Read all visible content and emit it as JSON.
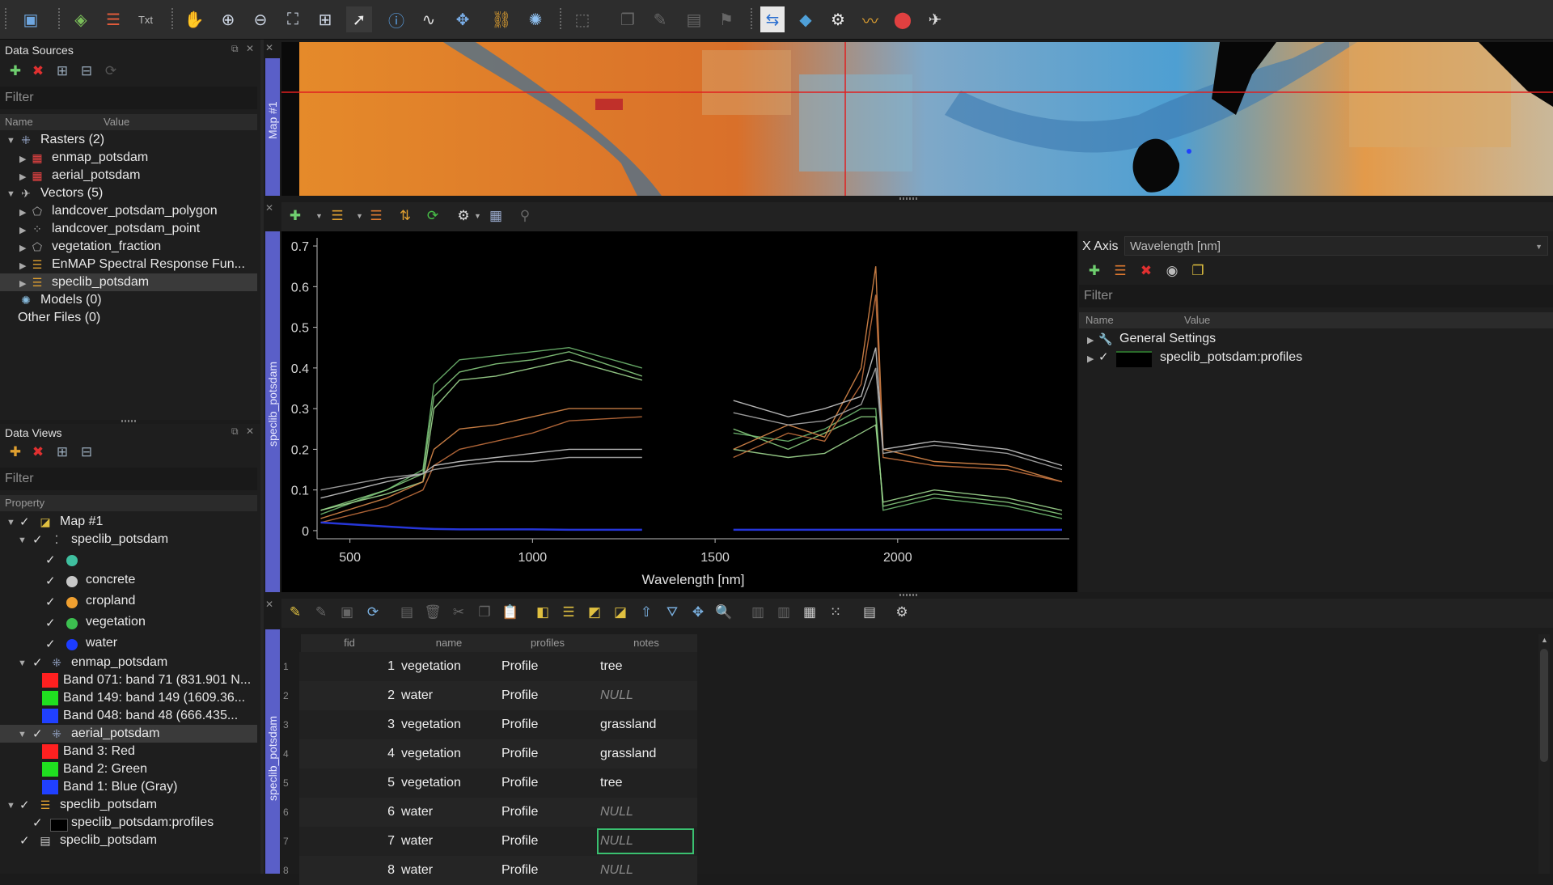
{
  "data_sources": {
    "title": "Data Sources",
    "filter_placeholder": "Filter",
    "col_name": "Name",
    "col_value": "Value",
    "rasters_label": "Rasters (2)",
    "raster_items": [
      "enmap_potsdam",
      "aerial_potsdam"
    ],
    "vectors_label": "Vectors (5)",
    "vector_items": [
      "landcover_potsdam_polygon",
      "landcover_potsdam_point",
      "vegetation_fraction",
      "EnMAP Spectral Response Fun...",
      "speclib_potsdam"
    ],
    "models_label": "Models (0)",
    "other_files_label": "Other Files (0)"
  },
  "data_views": {
    "title": "Data Views",
    "filter_placeholder": "Filter",
    "col_property": "Property",
    "map_label": "Map #1",
    "speclib_layer": "speclib_potsdam",
    "classes": [
      {
        "label": "",
        "color": "#3fbf9f"
      },
      {
        "label": "concrete",
        "color": "#c8c8c8"
      },
      {
        "label": "cropland",
        "color": "#f0a030"
      },
      {
        "label": "vegetation",
        "color": "#3cc050"
      },
      {
        "label": "water",
        "color": "#1c3cff"
      }
    ],
    "enmap_layer": "enmap_potsdam",
    "enmap_bands": [
      {
        "label": "Band 071: band 71 (831.901 N...",
        "color": "#ff2020"
      },
      {
        "label": "Band 149: band 149 (1609.36...",
        "color": "#20e020"
      },
      {
        "label": "Band 048: band 48 (666.435...",
        "color": "#2040ff"
      }
    ],
    "aerial_layer": "aerial_potsdam",
    "aerial_bands": [
      {
        "label": "Band 3: Red",
        "color": "#ff2020"
      },
      {
        "label": "Band 2: Green",
        "color": "#20e020"
      },
      {
        "label": "Band 1: Blue (Gray)",
        "color": "#2040ff"
      }
    ],
    "speclib_view": "speclib_potsdam",
    "speclib_profiles": "speclib_potsdam:profiles",
    "speclib_table": "speclib_potsdam"
  },
  "map_tab": "Map #1",
  "speclib_tab": "speclib_potsdam",
  "table_tab": "speclib_potsdam",
  "plot_settings": {
    "xaxis_label": "X Axis",
    "xaxis_value": "Wavelength [nm]",
    "filter_placeholder": "Filter",
    "col_name": "Name",
    "col_value": "Value",
    "general_settings": "General Settings",
    "profile_layer": "speclib_potsdam:profiles"
  },
  "chart_data": {
    "type": "line",
    "xlabel": "Wavelength [nm]",
    "ylabel": "",
    "xlim": [
      410,
      2470
    ],
    "ylim": [
      -0.02,
      0.72
    ],
    "xticks": [
      500,
      1000,
      1500,
      2000
    ],
    "yticks": [
      0,
      0.1,
      0.2,
      0.3,
      0.4,
      0.5,
      0.6,
      0.7
    ],
    "series": [
      {
        "color": "#6fb870",
        "x": [
          420,
          600,
          700,
          730,
          800,
          900,
          1000,
          1100,
          1300,
          1450,
          1460,
          1550,
          1700,
          1800,
          1900,
          1940,
          1960,
          2100,
          2300,
          2450
        ],
        "y": [
          0.04,
          0.1,
          0.15,
          0.36,
          0.42,
          0.43,
          0.44,
          0.45,
          0.4,
          null,
          null,
          0.24,
          0.22,
          0.25,
          0.3,
          0.3,
          0.05,
          0.08,
          0.06,
          0.03
        ]
      },
      {
        "color": "#88cc80",
        "x": [
          420,
          600,
          700,
          730,
          800,
          900,
          1000,
          1100,
          1300,
          1450,
          1460,
          1550,
          1700,
          1800,
          1900,
          1940,
          1960,
          2100,
          2300,
          2450
        ],
        "y": [
          0.05,
          0.1,
          0.14,
          0.33,
          0.39,
          0.41,
          0.42,
          0.44,
          0.38,
          null,
          null,
          0.25,
          0.2,
          0.24,
          0.28,
          0.28,
          0.06,
          0.09,
          0.07,
          0.04
        ]
      },
      {
        "color": "#a0d890",
        "x": [
          420,
          600,
          700,
          730,
          800,
          900,
          1000,
          1100,
          1300,
          1450,
          1460,
          1550,
          1700,
          1800,
          1900,
          1940,
          1960,
          2100,
          2300,
          2450
        ],
        "y": [
          0.05,
          0.09,
          0.12,
          0.3,
          0.37,
          0.38,
          0.4,
          0.42,
          0.37,
          null,
          null,
          0.2,
          0.18,
          0.19,
          0.24,
          0.26,
          0.07,
          0.1,
          0.08,
          0.05
        ]
      },
      {
        "color": "#d9884a",
        "x": [
          420,
          600,
          700,
          730,
          800,
          900,
          1000,
          1100,
          1300,
          1450,
          1460,
          1550,
          1700,
          1800,
          1900,
          1940,
          1960,
          2100,
          2300,
          2450
        ],
        "y": [
          0.03,
          0.08,
          0.12,
          0.2,
          0.25,
          0.26,
          0.28,
          0.3,
          0.3,
          null,
          null,
          0.2,
          0.26,
          0.23,
          0.4,
          0.65,
          0.2,
          0.17,
          0.16,
          0.12
        ]
      },
      {
        "color": "#c06e3c",
        "x": [
          420,
          600,
          700,
          730,
          800,
          900,
          1000,
          1100,
          1300,
          1450,
          1460,
          1550,
          1700,
          1800,
          1900,
          1940,
          1960,
          2100,
          2300,
          2450
        ],
        "y": [
          0.02,
          0.06,
          0.1,
          0.16,
          0.2,
          0.22,
          0.24,
          0.27,
          0.28,
          null,
          null,
          0.18,
          0.24,
          0.22,
          0.36,
          0.58,
          0.18,
          0.16,
          0.15,
          0.12
        ]
      },
      {
        "color": "#c7c7c7",
        "x": [
          420,
          600,
          700,
          730,
          800,
          900,
          1000,
          1100,
          1300,
          1450,
          1460,
          1550,
          1700,
          1800,
          1900,
          1940,
          1960,
          2100,
          2300,
          2450
        ],
        "y": [
          0.08,
          0.12,
          0.14,
          0.16,
          0.17,
          0.18,
          0.19,
          0.2,
          0.2,
          null,
          null,
          0.32,
          0.28,
          0.3,
          0.33,
          0.45,
          0.2,
          0.22,
          0.2,
          0.16
        ]
      },
      {
        "color": "#a9a9a9",
        "x": [
          420,
          600,
          700,
          730,
          800,
          900,
          1000,
          1100,
          1300,
          1450,
          1460,
          1550,
          1700,
          1800,
          1900,
          1940,
          1960,
          2100,
          2300,
          2450
        ],
        "y": [
          0.1,
          0.13,
          0.14,
          0.15,
          0.16,
          0.17,
          0.17,
          0.18,
          0.18,
          null,
          null,
          0.29,
          0.26,
          0.27,
          0.31,
          0.4,
          0.19,
          0.21,
          0.19,
          0.15
        ]
      },
      {
        "color": "#2a3cf0",
        "x": [
          420,
          600,
          700,
          730,
          800,
          900,
          1000,
          1100,
          1300,
          1450,
          1460,
          1550,
          1700,
          1800,
          1900,
          1940,
          1960,
          2100,
          2300,
          2450
        ],
        "y": [
          0.02,
          0.01,
          0.005,
          0.004,
          0.003,
          0.003,
          0.003,
          0.002,
          0.002,
          null,
          null,
          0.002,
          0.002,
          0.002,
          0.002,
          0.002,
          0.002,
          0.002,
          0.002,
          0.002
        ]
      }
    ]
  },
  "table": {
    "columns": [
      "fid",
      "name",
      "profiles",
      "notes"
    ],
    "rows": [
      {
        "num": "1",
        "fid": "1",
        "name": "vegetation",
        "profiles": "Profile",
        "notes": "tree"
      },
      {
        "num": "2",
        "fid": "2",
        "name": "water",
        "profiles": "Profile",
        "notes": "NULL"
      },
      {
        "num": "3",
        "fid": "3",
        "name": "vegetation",
        "profiles": "Profile",
        "notes": "grassland"
      },
      {
        "num": "4",
        "fid": "4",
        "name": "vegetation",
        "profiles": "Profile",
        "notes": "grassland"
      },
      {
        "num": "5",
        "fid": "5",
        "name": "vegetation",
        "profiles": "Profile",
        "notes": "tree"
      },
      {
        "num": "6",
        "fid": "6",
        "name": "water",
        "profiles": "Profile",
        "notes": "NULL"
      },
      {
        "num": "7",
        "fid": "7",
        "name": "water",
        "profiles": "Profile",
        "notes": "NULL"
      },
      {
        "num": "8",
        "fid": "8",
        "name": "water",
        "profiles": "Profile",
        "notes": "NULL"
      }
    ]
  },
  "icons": [
    "folder-icon",
    "add-raster-icon",
    "database-icon",
    "text-icon",
    "pan-hand-icon",
    "zoom-in-icon",
    "zoom-out-icon",
    "zoom-full-icon",
    "zoom-pixel-icon",
    "select-cursor-icon",
    "info-icon",
    "spectral-profile-icon",
    "move-center-icon",
    "link-icon",
    "settings-icon",
    "select-rect-icon",
    "layers-icon",
    "edit-icon",
    "map-compare-icon",
    "stack-icon",
    "process-gear-icon",
    "wave-icon",
    "location-pin-icon",
    "satellite-icon"
  ]
}
